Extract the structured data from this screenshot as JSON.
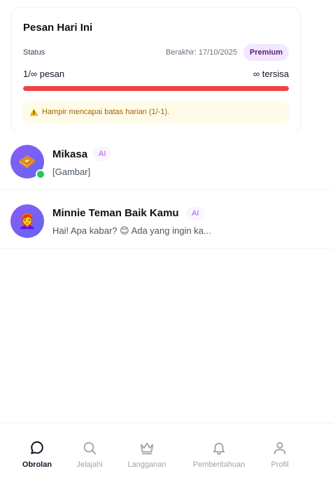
{
  "usage": {
    "title": "Pesan Hari Ini",
    "status_label": "Status",
    "expiry": "Berakhir: 17/10/2025",
    "plan_badge": "Premium",
    "count_left": "1/∞ pesan",
    "count_right": "∞ tersisa",
    "progress_fraction": 1.0,
    "progress_color": "#ef4444",
    "warning_text": "Hampir mencapai batas harian (1/-1)."
  },
  "chats": [
    {
      "name": "Mikasa",
      "badge": "AI",
      "preview": "[Gambar]",
      "avatar_emoji": "🧇",
      "online": true
    },
    {
      "name": "Minnie Teman Baik Kamu",
      "badge": "AI",
      "preview": "Hai! Apa kabar? 😊 Ada yang ingin ka...",
      "avatar_emoji": "👩‍🦰",
      "online": false
    }
  ],
  "nav": {
    "items": [
      {
        "label": "Obrolan",
        "icon": "chat-bubble-icon",
        "active": true
      },
      {
        "label": "Jelajahi",
        "icon": "search-icon",
        "active": false
      },
      {
        "label": "Langganan",
        "icon": "crown-icon",
        "active": false
      },
      {
        "label": "Pemberitahuan",
        "icon": "bell-icon",
        "active": false
      },
      {
        "label": "Profil",
        "icon": "user-icon",
        "active": false
      }
    ]
  },
  "colors": {
    "accent": "#581c87",
    "ai_badge": "#a855f7",
    "online": "#22c55e",
    "warning": "#a16207"
  }
}
